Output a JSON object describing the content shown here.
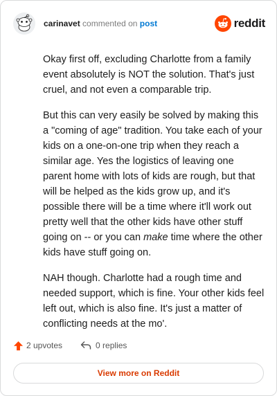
{
  "comment": {
    "username": "carinavet",
    "action_text": "commented on",
    "post_link_label": "post",
    "brand_name": "reddit",
    "paragraphs": [
      {
        "before": "Okay first off, excluding Charlotte from a family event absolutely is NOT the solution. That's just cruel, and not even a comparable trip.",
        "emphasis": "",
        "after": ""
      },
      {
        "before": "But this can very easily be solved by making this a \"coming of age\" tradition. You take each of your kids on a one-on-one trip when they reach a similar age. Yes the logistics of leaving one parent home with lots of kids are rough, but that will be helped as the kids grow up, and it's possible there will be a time where it'll work out pretty well that the other kids have other stuff going on -- or you can ",
        "emphasis": "make",
        "after": " time where the other kids have stuff going on."
      },
      {
        "before": "NAH though. Charlotte had a rough time and needed support, which is fine. Your other kids feel left out, which is also fine. It's just a matter of conflicting needs at the mo'.",
        "emphasis": "",
        "after": ""
      }
    ],
    "upvotes_label": "2 upvotes",
    "replies_label": "0 replies",
    "view_more_label": "View more on Reddit"
  },
  "icons": {
    "avatar": "reddit-snoo-avatar-icon",
    "brand": "reddit-logo-icon",
    "upvote": "upvote-arrow-icon",
    "reply": "reply-arrow-icon"
  },
  "colors": {
    "accent": "#ff4500",
    "link": "#0079d3",
    "view_more_text": "#d93a00",
    "border": "#d9dadb"
  }
}
